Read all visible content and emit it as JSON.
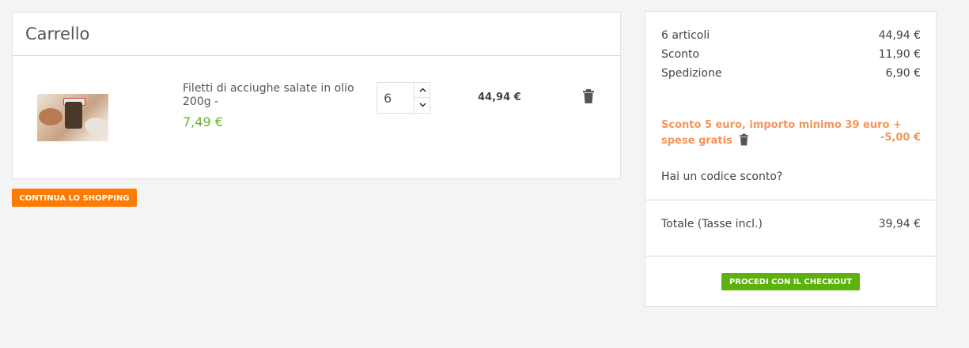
{
  "cart": {
    "title": "Carrello",
    "item": {
      "name": "Filetti di acciughe salate in olio 200g - ",
      "unit_price": "7,49 €",
      "quantity": "6",
      "line_total": "44,94 €",
      "qty_up_icon": "chevron-up-icon",
      "qty_down_icon": "chevron-down-icon",
      "remove_icon": "trash-icon"
    },
    "continue_label": "CONTINUA LO SHOPPING"
  },
  "summary": {
    "rows": [
      {
        "label": "6 articoli",
        "value": "44,94 €"
      },
      {
        "label": "Sconto",
        "value": "11,90 €"
      },
      {
        "label": "Spedizione",
        "value": "6,90 €"
      }
    ],
    "promo": {
      "label_line1": "Sconto 5 euro, importo minimo 39 euro +",
      "label_line2": "spese gratis",
      "value": "-5,00 €"
    },
    "discount_code_link": "Hai un codice sconto?",
    "total_label": "Totale (Tasse incl.)",
    "total_value": "39,94 €",
    "checkout_label": "PROCEDI CON IL CHECKOUT"
  },
  "colors": {
    "background": "#f4f4f4",
    "price_green": "#6ab023",
    "continue_orange": "#ff7a00",
    "promo_orange": "#f5955a",
    "checkout_green": "#5cb10c"
  }
}
